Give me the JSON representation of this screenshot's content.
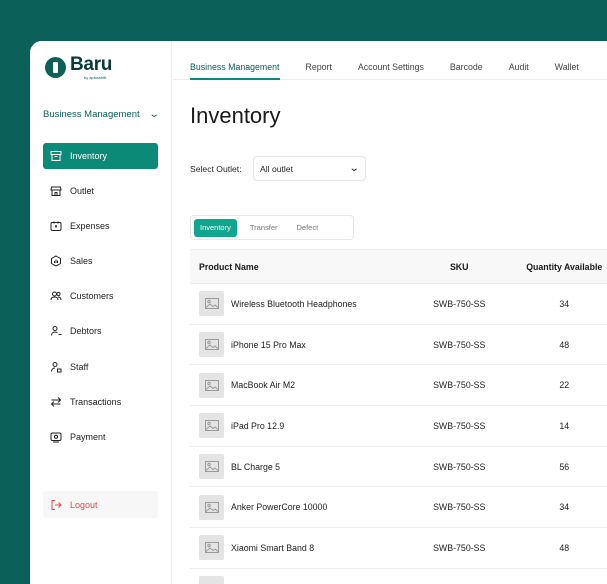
{
  "brand": {
    "name": "Baru",
    "tagline": "by aplusshift"
  },
  "sidebar": {
    "section_selector": "Business Management",
    "items": [
      {
        "label": "Inventory",
        "icon": "box-icon",
        "active": true
      },
      {
        "label": "Outlet",
        "icon": "store-icon"
      },
      {
        "label": "Expenses",
        "icon": "wallet-icon"
      },
      {
        "label": "Sales",
        "icon": "sales-icon"
      },
      {
        "label": "Customers",
        "icon": "users-icon"
      },
      {
        "label": "Debtors",
        "icon": "user-minus-icon"
      },
      {
        "label": "Staff",
        "icon": "staff-icon"
      },
      {
        "label": "Transactions",
        "icon": "arrows-icon"
      },
      {
        "label": "Payment",
        "icon": "payment-icon"
      }
    ],
    "logout_label": "Logout"
  },
  "topnav": {
    "tabs": [
      "Business Management",
      "Report",
      "Account Settings",
      "Barcode",
      "Audit",
      "Wallet"
    ],
    "active": "Business Management"
  },
  "page": {
    "title": "Inventory",
    "outlet_label": "Select Outlet:",
    "outlet_value": "All outlet",
    "segments": [
      "Inventory",
      "Transfer",
      "Defect"
    ],
    "active_segment": "Inventory"
  },
  "table": {
    "columns": [
      "Product Name",
      "SKU",
      "Quantity Available"
    ],
    "rows": [
      {
        "name": "Wireless Bluetooth Headphones",
        "sku": "SWB-750-SS",
        "qty": "34"
      },
      {
        "name": "iPhone 15 Pro Max",
        "sku": "SWB-750-SS",
        "qty": "48"
      },
      {
        "name": "MacBook Air M2",
        "sku": "SWB-750-SS",
        "qty": "22"
      },
      {
        "name": "iPad Pro 12.9",
        "sku": "SWB-750-SS",
        "qty": "14"
      },
      {
        "name": "BL Charge 5",
        "sku": "SWB-750-SS",
        "qty": "56"
      },
      {
        "name": "Anker PowerCore 10000",
        "sku": "SWB-750-SS",
        "qty": "34"
      },
      {
        "name": "Xiaomi Smart Band 8",
        "sku": "SWB-750-SS",
        "qty": "48"
      }
    ]
  },
  "colors": {
    "brand": "#0b6159",
    "accent": "#0b8a78",
    "danger": "#e04b4b"
  }
}
